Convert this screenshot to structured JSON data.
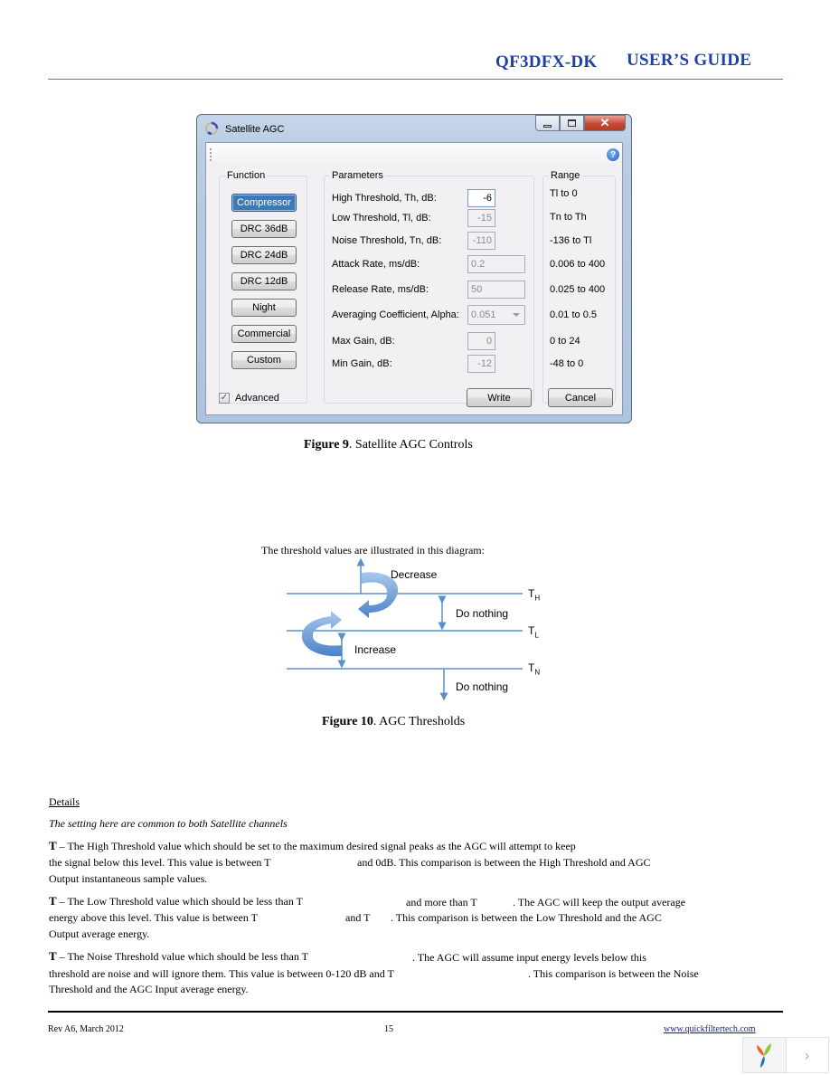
{
  "header": {
    "product": "QF3DFX-DK",
    "guide": "USER’S GUIDE",
    "accent_color": "#1f3fa8",
    "rule_color": "#4f81bd"
  },
  "window": {
    "title": "Satellite AGC",
    "icon": "app-swirl-icon",
    "controls": {
      "minimize": "minimize-icon",
      "maximize": "maximize-icon",
      "close": "close-icon"
    },
    "help_icon": "help-icon",
    "function_group": {
      "legend": "Function",
      "buttons": [
        "Compressor",
        "DRC 36dB",
        "DRC 24dB",
        "DRC 12dB",
        "Night",
        "Commercial",
        "Custom"
      ],
      "selected": "Compressor",
      "selected_color": "#3d7ab5"
    },
    "parameters_group": {
      "legend": "Parameters",
      "fields": [
        {
          "label": "High Threshold, Th, dB:",
          "value": "-6"
        },
        {
          "label": "Low Threshold, Tl, dB:",
          "value": "-15"
        },
        {
          "label": "Noise Threshold, Tn, dB:",
          "value": "-110"
        },
        {
          "label": "Attack Rate, ms/dB:",
          "value": "0.2"
        },
        {
          "label": "Release Rate, ms/dB:",
          "value": "50"
        },
        {
          "label": "Averaging Coefficient, Alpha:",
          "value": "0.051"
        },
        {
          "label": "Max Gain, dB:",
          "value": "0"
        },
        {
          "label": "Min Gain, dB:",
          "value": "-12"
        }
      ]
    },
    "range_group": {
      "legend": "Range",
      "items": [
        "Tl to 0",
        "Tn to Th",
        "-136 to Tl",
        "0.006 to 400",
        "0.025 to 400",
        "0.01 to 0.5",
        "0 to 24",
        "-48 to 0"
      ]
    },
    "advanced": {
      "label": "Advanced",
      "checked": true
    },
    "write_label": "Write",
    "cancel_label": "Cancel"
  },
  "figure9": {
    "prefix": "Figure 9",
    "text": ". Satellite AGC Controls"
  },
  "diagram": {
    "intro": "The threshold values are illustrated in this diagram:",
    "decrease": "Decrease",
    "increase": "Increase",
    "do_nothing_1": "Do nothing",
    "do_nothing_2": "Do nothing",
    "th": {
      "base": "T",
      "sub": "H"
    },
    "tl": {
      "base": "T",
      "sub": "L"
    },
    "tn": {
      "base": "T",
      "sub": "N"
    },
    "line_color": "#5b8fca"
  },
  "figure10": {
    "prefix": "Figure 10",
    "text": ". AGC Thresholds"
  },
  "details": {
    "heading": "Details",
    "note": "The setting here are common to both Satellite channels",
    "th": {
      "sym": "T",
      "line1": " – The High Threshold value which should be set to the maximum desired signal peaks as the AGC will attempt to keep",
      "line2a": "the signal below this level. This value is between T",
      "line2b": "and 0dB.  This comparison is between the High Threshold and AGC",
      "line3": "Output instantaneous sample values."
    },
    "tl": {
      "sym": "T",
      "line1a": " – The Low Threshold value which should be less than T",
      "line1b": "and more than T",
      "line1c": ". The AGC will keep the output average",
      "line2a": "energy above this level. This value is between T",
      "line2b": "and T",
      "line2c": ".  This comparison is between the Low Threshold and the AGC",
      "line3": "Output average energy."
    },
    "tn": {
      "sym": "T",
      "line1a": " – The Noise Threshold value which should be less than T",
      "line1b": ". The AGC will assume input energy levels below this",
      "line2a": "threshold are noise and will ignore them. This value is between 0-120 dB and T",
      "line2b": ". This comparison is between the Noise",
      "line3": "Threshold and the AGC Input average energy."
    }
  },
  "footer": {
    "revision": "Rev A6, March 2012",
    "page": "15",
    "link": "www.quickfiltertech.com"
  },
  "widget": {
    "logo": "app-logo-icon",
    "next": "›"
  }
}
